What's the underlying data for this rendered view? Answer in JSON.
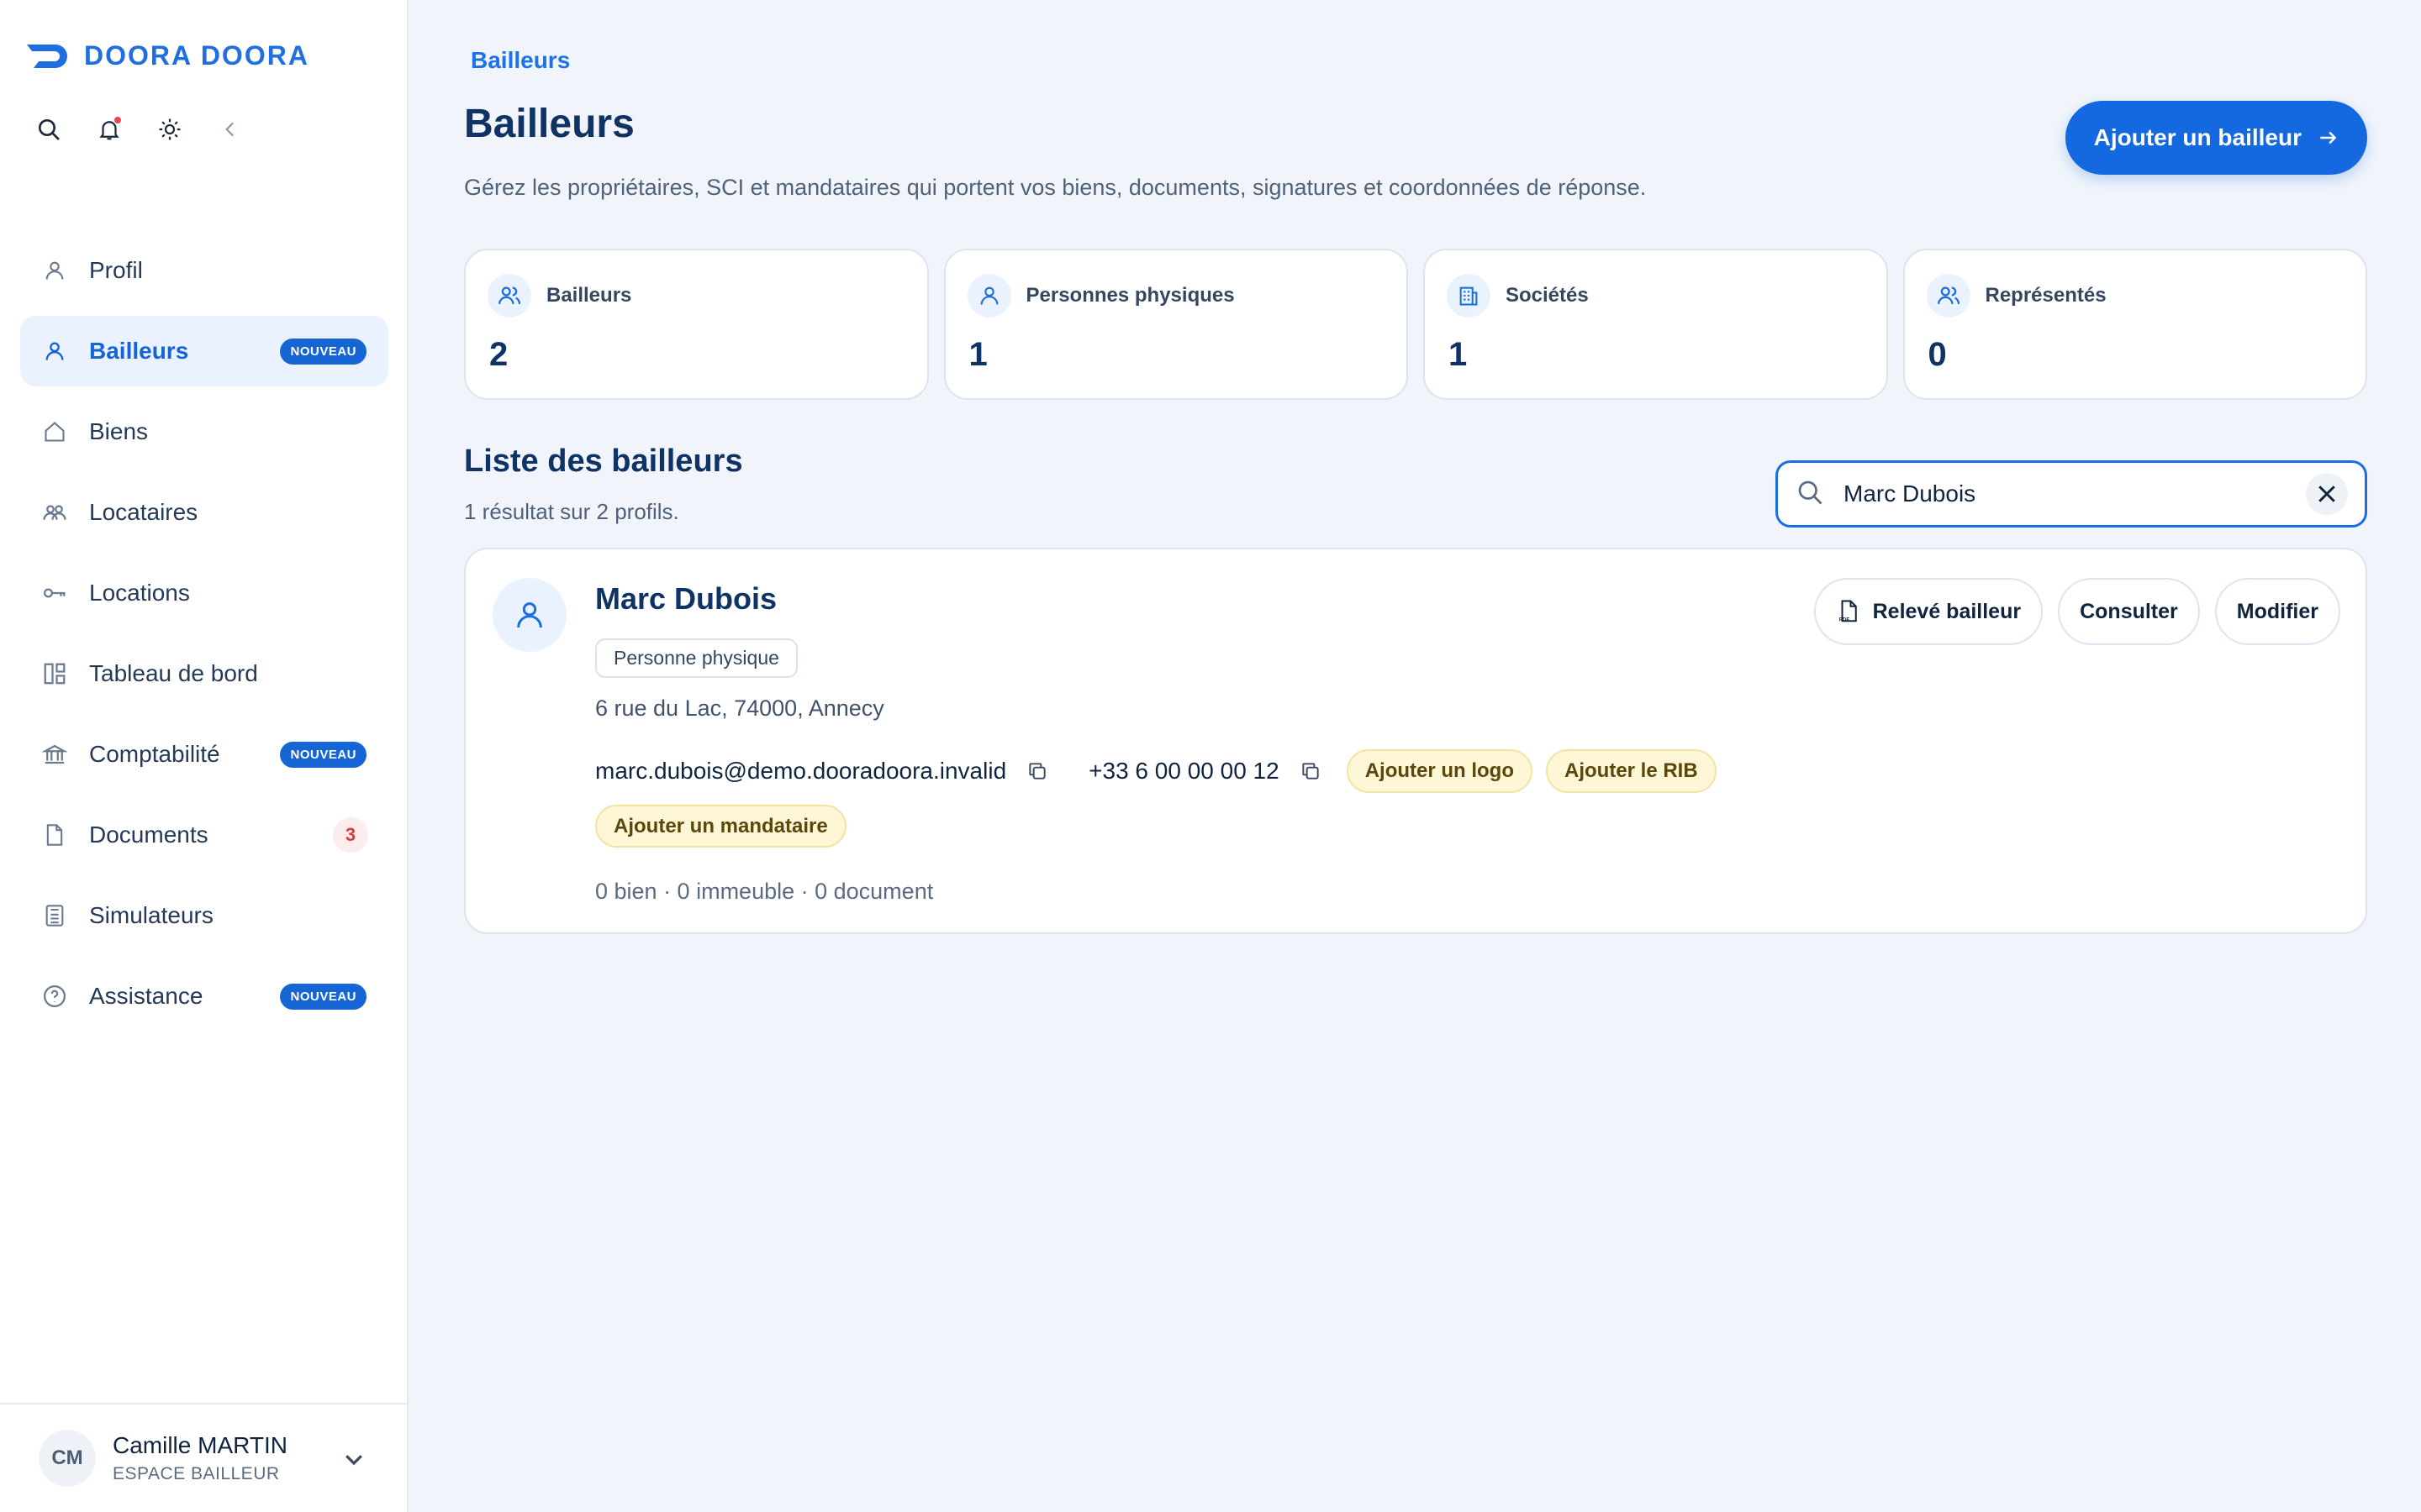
{
  "app": {
    "brand": "DOORA DOORA",
    "accent": "#1468e0"
  },
  "sidebar": {
    "items": [
      {
        "label": "Profil",
        "icon": "user-icon",
        "active": false
      },
      {
        "label": "Bailleurs",
        "icon": "user-icon",
        "active": true,
        "badge": "NOUVEAU"
      },
      {
        "label": "Biens",
        "icon": "home-icon",
        "active": false
      },
      {
        "label": "Locataires",
        "icon": "users-icon",
        "active": false
      },
      {
        "label": "Locations",
        "icon": "key-icon",
        "active": false
      },
      {
        "label": "Tableau de bord",
        "icon": "dashboard-icon",
        "active": false
      },
      {
        "label": "Comptabilité",
        "icon": "bank-icon",
        "active": false,
        "badge": "NOUVEAU"
      },
      {
        "label": "Documents",
        "icon": "document-icon",
        "active": false,
        "count": "3"
      },
      {
        "label": "Simulateurs",
        "icon": "calculator-icon",
        "active": false
      },
      {
        "label": "Assistance",
        "icon": "help-icon",
        "active": false,
        "badge": "NOUVEAU"
      }
    ],
    "user": {
      "initials": "CM",
      "name": "Camille MARTIN",
      "role": "ESPACE BAILLEUR"
    }
  },
  "header": {
    "breadcrumb": "Bailleurs",
    "title": "Bailleurs",
    "description": "Gérez les propriétaires, SCI et mandataires qui portent vos biens, documents, signatures et coordonnées de réponse.",
    "add_button": "Ajouter un bailleur"
  },
  "stats": [
    {
      "label": "Bailleurs",
      "value": "2",
      "icon": "users-icon"
    },
    {
      "label": "Personnes physiques",
      "value": "1",
      "icon": "user-icon"
    },
    {
      "label": "Sociétés",
      "value": "1",
      "icon": "building-icon"
    },
    {
      "label": "Représentés",
      "value": "0",
      "icon": "users-icon"
    }
  ],
  "list": {
    "title": "Liste des bailleurs",
    "subtitle": "1 résultat sur 2 profils.",
    "search_value": "Marc Dubois"
  },
  "landlord": {
    "name": "Marc Dubois",
    "type": "Personne physique",
    "address": "6 rue du Lac, 74000, Annecy",
    "email": "marc.dubois@demo.dooradoora.invalid",
    "phone": "+33 6 00 00 00 12",
    "pill_logo": "Ajouter un logo",
    "pill_rib": "Ajouter le RIB",
    "pill_mandataire": "Ajouter un mandataire",
    "meta": "0 bien · 0 immeuble · 0 document",
    "actions": {
      "statement": "Relevé bailleur",
      "view": "Consulter",
      "edit": "Modifier"
    }
  }
}
